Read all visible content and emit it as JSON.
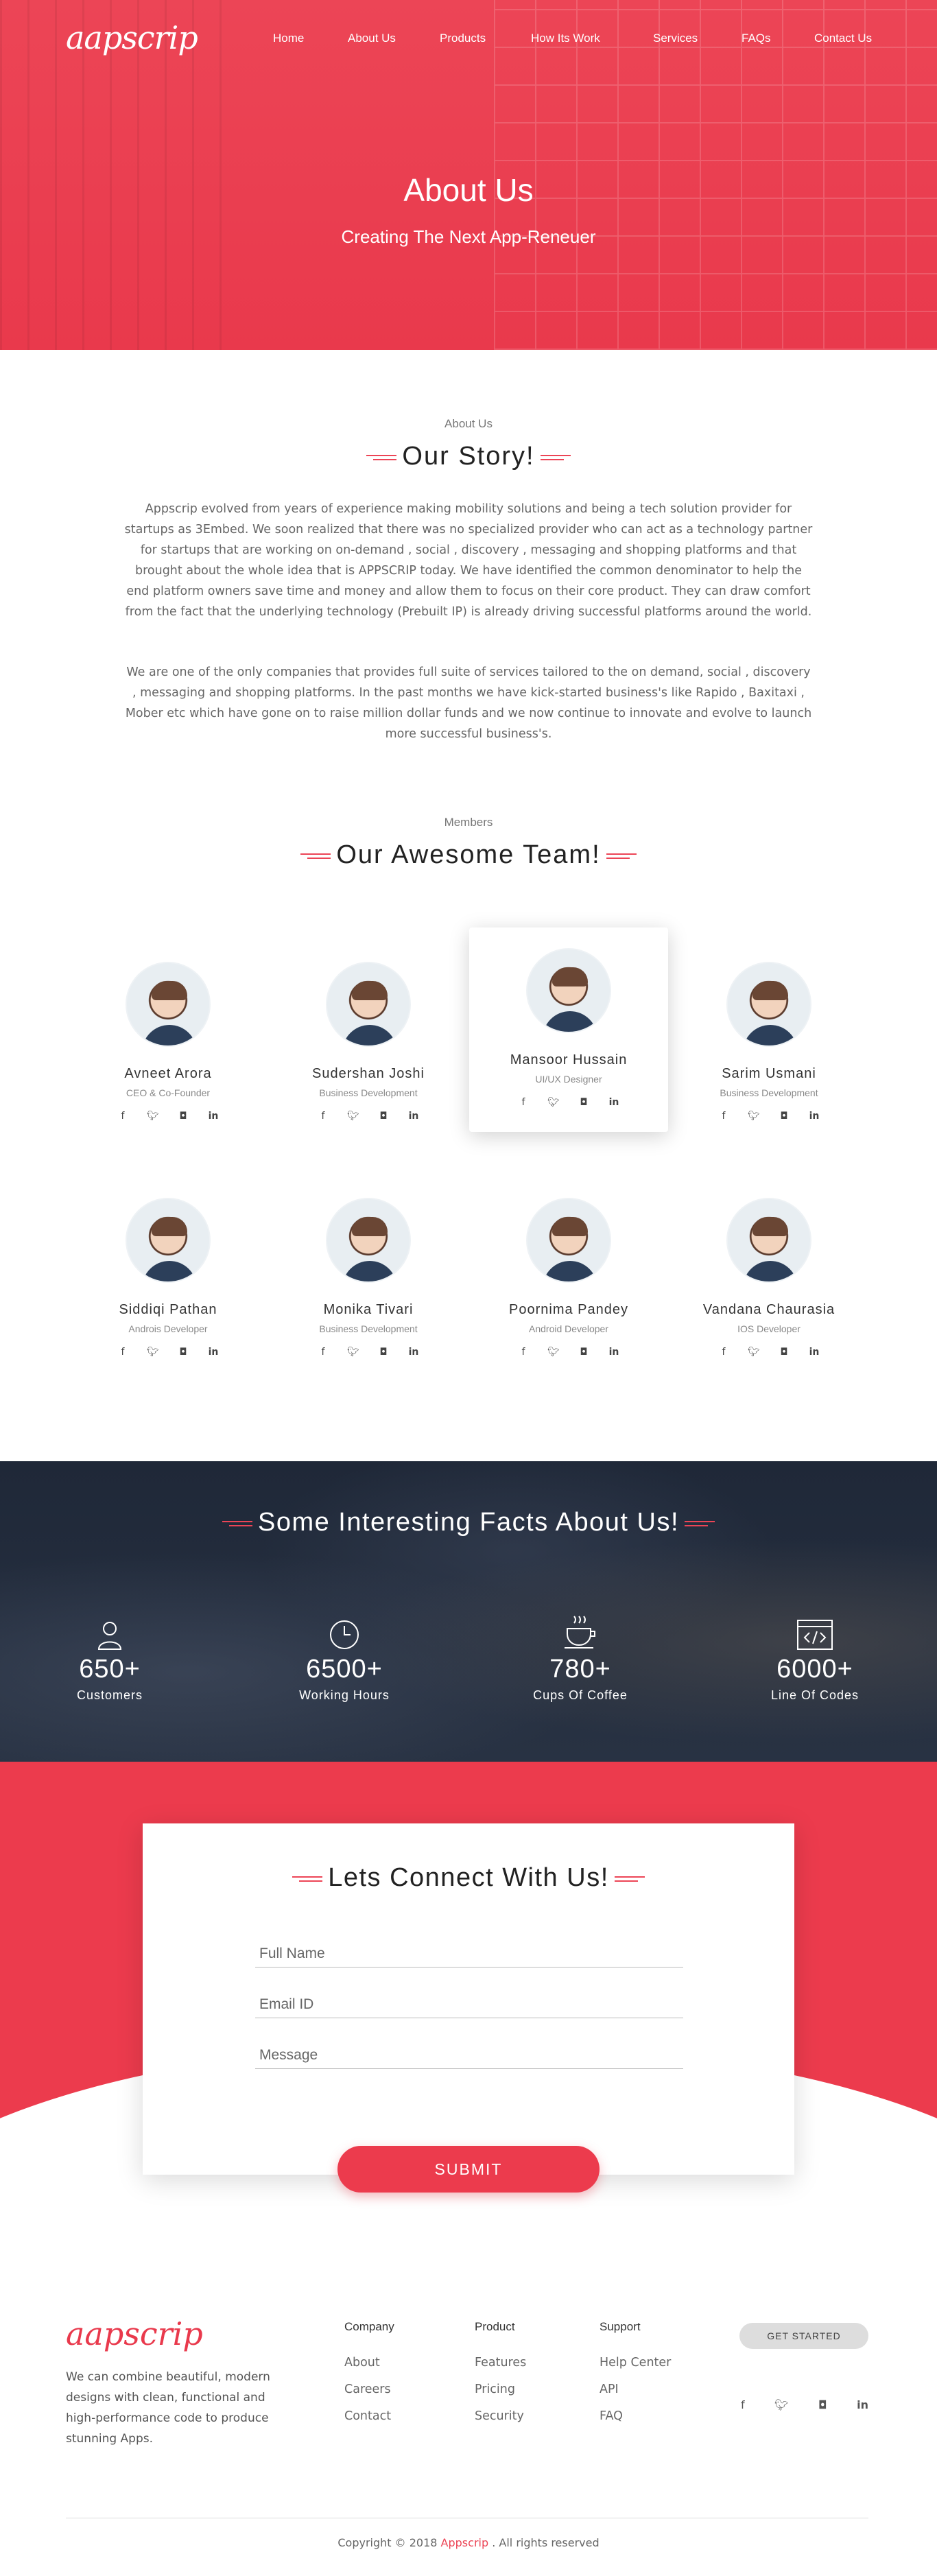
{
  "header": {
    "logo": "aapscrip",
    "nav": [
      "Home",
      "About Us",
      "Products",
      "How Its Work",
      "Services",
      "FAQs",
      "Contact Us"
    ]
  },
  "hero": {
    "title": "About Us",
    "subtitle": "Creating The Next App-Reneuer"
  },
  "story": {
    "label": "About Us",
    "title": "Our Story!",
    "p1": "Appscrip evolved from years of experience making mobility solutions and being a tech solution provider for startups as 3Embed. We soon realized that there was no specialized provider who can act as a technology partner for startups that are working on on-demand , social , discovery , messaging and shopping platforms and that brought about the whole idea that is APPSCRIP today. We have identified the common denominator to help the end platform owners save time and money and allow them to focus on their core product. They can draw comfort from the fact that the underlying technology (Prebuilt IP) is already driving successful platforms around the world.",
    "p2": "We are one of the only companies that provides full suite of services tailored to the on demand, social , discovery , messaging and shopping platforms. In the past months we have kick-started business's like Rapido , Baxitaxi , Mober etc which have gone on to raise million dollar funds and we now continue to innovate and evolve to launch more successful business's."
  },
  "team": {
    "label": "Members",
    "title": "Our Awesome Team!",
    "members": [
      {
        "name": "Avneet Arora",
        "role": "CEO & Co-Founder"
      },
      {
        "name": "Sudershan Joshi",
        "role": "Business Development"
      },
      {
        "name": "Mansoor Hussain",
        "role": "UI/UX Designer"
      },
      {
        "name": "Sarim Usmani",
        "role": "Business Development"
      },
      {
        "name": "Siddiqi Pathan",
        "role": "Androis Developer"
      },
      {
        "name": "Monika Tivari",
        "role": "Business Development"
      },
      {
        "name": "Poornima Pandey",
        "role": "Android Developer"
      },
      {
        "name": "Vandana Chaurasia",
        "role": "IOS Developer"
      }
    ],
    "social_icons": [
      "facebook-icon",
      "twitter-icon",
      "instagram-icon",
      "linkedin-icon"
    ]
  },
  "facts": {
    "title": "Some Interesting Facts About Us!",
    "items": [
      {
        "num": "650+",
        "label": "Customers",
        "icon": "user-icon"
      },
      {
        "num": "6500+",
        "label": "Working Hours",
        "icon": "clock-icon"
      },
      {
        "num": "780+",
        "label": "Cups Of Coffee",
        "icon": "coffee-cup-icon"
      },
      {
        "num": "6000+",
        "label": "Line Of Codes",
        "icon": "code-window-icon"
      }
    ]
  },
  "connect": {
    "title": "Lets Connect With Us!",
    "full_name": "Full Name",
    "email": "Email ID",
    "message": "Message",
    "submit": "SUBMIT"
  },
  "footer": {
    "logo": "aapscrip",
    "desc": "We can combine beautiful, modern designs with clean, functional and high-performance code to produce stunning Apps.",
    "company": {
      "title": "Company",
      "links": [
        "About",
        "Careers",
        "Contact"
      ]
    },
    "product": {
      "title": "Product",
      "links": [
        "Features",
        "Pricing",
        "Security"
      ]
    },
    "support": {
      "title": "Support",
      "links": [
        "Help Center",
        "API",
        "FAQ"
      ]
    },
    "get_started": "GET STARTED",
    "copyright_pre": "Copyright © 2018",
    "copyright_brand": "Appscrip",
    "copyright_post": ". All rights reserved"
  },
  "colors": {
    "accent": "#ec4556",
    "dark": "#1f2838"
  }
}
